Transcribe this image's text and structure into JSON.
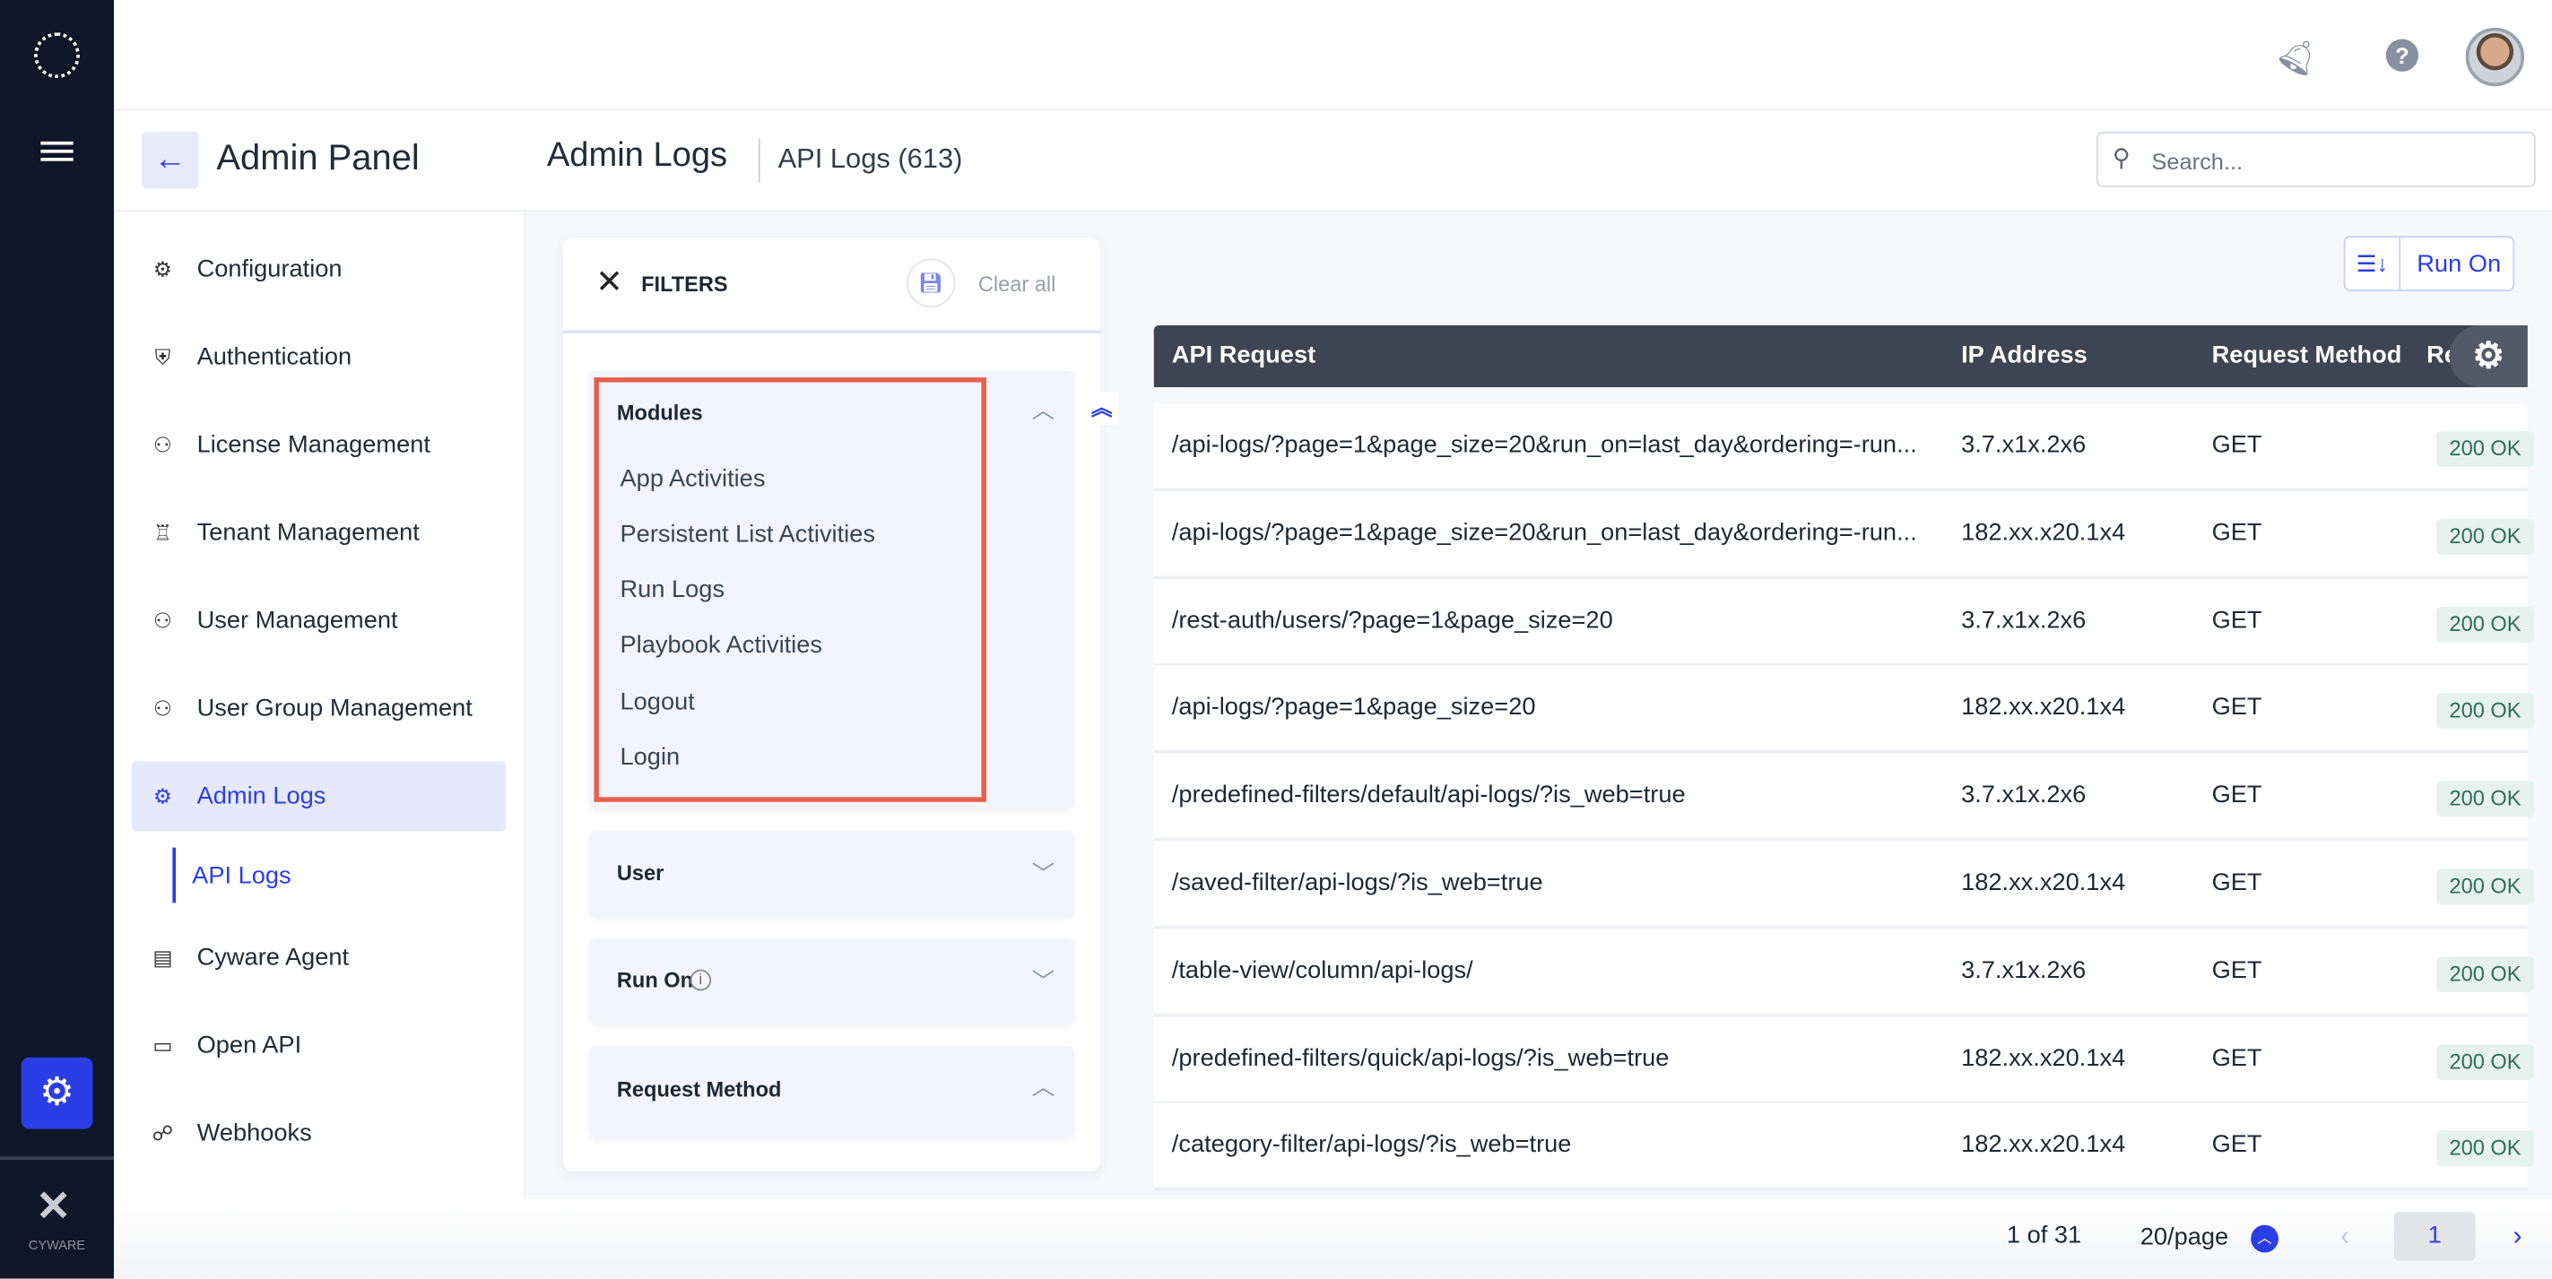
{
  "rail": {
    "brand": "CYWARE"
  },
  "header": {
    "title": "Admin Panel",
    "section": "Admin Logs",
    "subsection": "API Logs (613)",
    "search_placeholder": "Search..."
  },
  "nav": {
    "items": [
      {
        "label": "Configuration",
        "icon": "gear-network-icon"
      },
      {
        "label": "Authentication",
        "icon": "shield-lock-icon"
      },
      {
        "label": "License Management",
        "icon": "users-gear-icon"
      },
      {
        "label": "Tenant Management",
        "icon": "org-chart-icon"
      },
      {
        "label": "User Management",
        "icon": "user-gear-icon"
      },
      {
        "label": "User Group Management",
        "icon": "users-gear-icon"
      },
      {
        "label": "Admin Logs",
        "icon": "gear-icon",
        "active": true
      },
      {
        "label": "Cyware Agent",
        "icon": "agent-icon"
      },
      {
        "label": "Open API",
        "icon": "terminal-icon"
      },
      {
        "label": "Webhooks",
        "icon": "webhook-icon"
      }
    ],
    "sub_item": "API Logs"
  },
  "filters": {
    "title": "FILTERS",
    "clear": "Clear all",
    "modules": {
      "title": "Modules",
      "options": [
        "App Activities",
        "Persistent List Activities",
        "Run Logs",
        "Playbook Activities",
        "Logout",
        "Login"
      ]
    },
    "sections": [
      "User",
      "Run On",
      "Request Method"
    ]
  },
  "toolbar": {
    "sort_label": "Run On"
  },
  "table": {
    "columns": [
      "API Request",
      "IP Address",
      "Request Method",
      "Re"
    ],
    "rows": [
      [
        "/api-logs/?page=1&page_size=20&run_on=last_day&ordering=-run...",
        "3.7.x1x.2x6",
        "GET",
        "200 OK"
      ],
      [
        "/api-logs/?page=1&page_size=20&run_on=last_day&ordering=-run...",
        "182.xx.x20.1x4",
        "GET",
        "200 OK"
      ],
      [
        "/rest-auth/users/?page=1&page_size=20",
        "3.7.x1x.2x6",
        "GET",
        "200 OK"
      ],
      [
        "/api-logs/?page=1&page_size=20",
        "182.xx.x20.1x4",
        "GET",
        "200 OK"
      ],
      [
        "/predefined-filters/default/api-logs/?is_web=true",
        "3.7.x1x.2x6",
        "GET",
        "200 OK"
      ],
      [
        "/saved-filter/api-logs/?is_web=true",
        "182.xx.x20.1x4",
        "GET",
        "200 OK"
      ],
      [
        "/table-view/column/api-logs/",
        "3.7.x1x.2x6",
        "GET",
        "200 OK"
      ],
      [
        "/predefined-filters/quick/api-logs/?is_web=true",
        "182.xx.x20.1x4",
        "GET",
        "200 OK"
      ],
      [
        "/category-filter/api-logs/?is_web=true",
        "182.xx.x20.1x4",
        "GET",
        "200 OK"
      ]
    ]
  },
  "pagination": {
    "range": "1 of 31",
    "per_page": "20/page",
    "current_page": "1"
  },
  "colors": {
    "accent": "#2b3ee6",
    "rail": "#0e1628",
    "table_header": "#3d4452",
    "highlight": "#e8604c"
  }
}
